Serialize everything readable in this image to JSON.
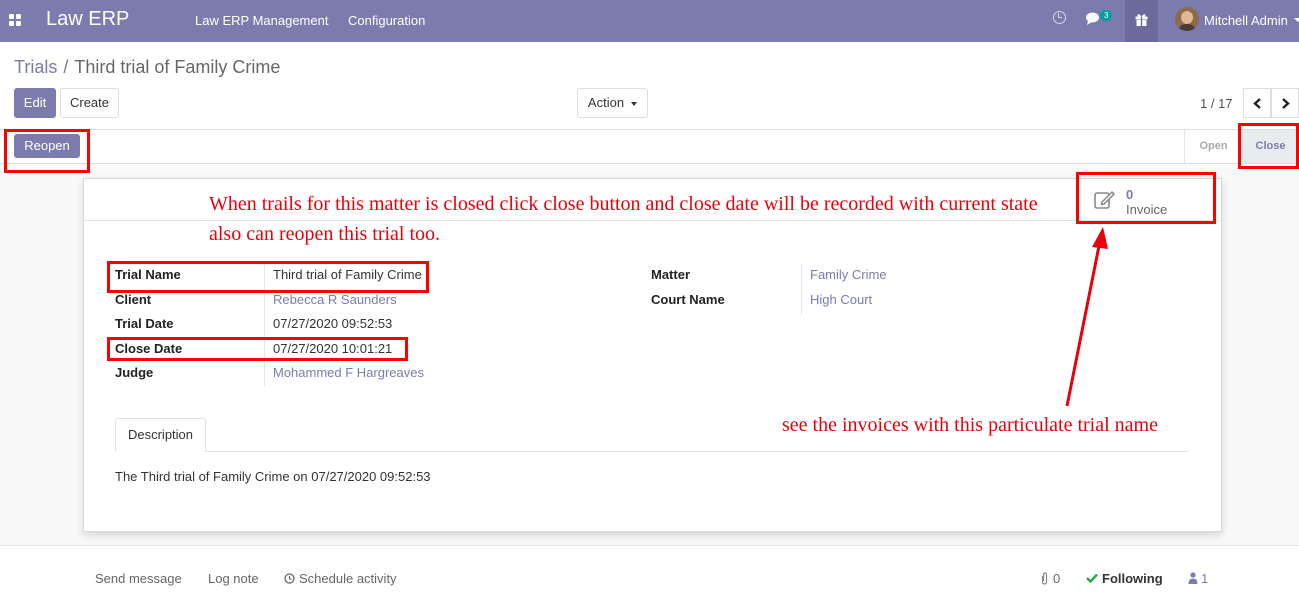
{
  "navbar": {
    "brand": "Law ERP",
    "menu": [
      "Law ERP Management",
      "Configuration"
    ],
    "chat_badge": "3",
    "user_name": "Mitchell Admin"
  },
  "breadcrumb": {
    "parent": "Trials",
    "separator": "/",
    "current": "Third trial of Family Crime"
  },
  "control": {
    "edit_label": "Edit",
    "create_label": "Create",
    "action_label": "Action",
    "pager_value": "1 / 17"
  },
  "statusbar": {
    "reopen_label": "Reopen",
    "states": [
      "Open",
      "Close"
    ],
    "active_state": "Close"
  },
  "smart_button": {
    "count": "0",
    "label": "Invoice"
  },
  "form": {
    "left": [
      {
        "label": "Trial Name",
        "value": "Third trial of Family Crime",
        "is_link": false
      },
      {
        "label": "Client",
        "value": "Rebecca R Saunders",
        "is_link": true
      },
      {
        "label": "Trial Date",
        "value": "07/27/2020 09:52:53",
        "is_link": false
      },
      {
        "label": "Close Date",
        "value": "07/27/2020 10:01:21",
        "is_link": false
      },
      {
        "label": "Judge",
        "value": "Mohammed F Hargreaves",
        "is_link": true
      }
    ],
    "right": [
      {
        "label": "Matter",
        "value": "Family Crime",
        "is_link": true
      },
      {
        "label": "Court Name",
        "value": "High Court",
        "is_link": true
      }
    ]
  },
  "tabs": {
    "description_label": "Description"
  },
  "description_text": "The Third trial of Family Crime on 07/27/2020 09:52:53",
  "annotations": {
    "line1": "When trails for this matter is closed click close button and close date will be recorded with current  state",
    "line2": "also can reopen this trial too.",
    "invoice_note": "see the invoices with this particulate trial name"
  },
  "chatter": {
    "send_message": "Send message",
    "log_note": "Log note",
    "schedule_activity": "Schedule activity",
    "attachments_count": "0",
    "following_label": "Following",
    "followers_count": "1"
  },
  "colors": {
    "brand": "#7c7bad",
    "annotation": "#e8000b",
    "following": "#28a745"
  }
}
